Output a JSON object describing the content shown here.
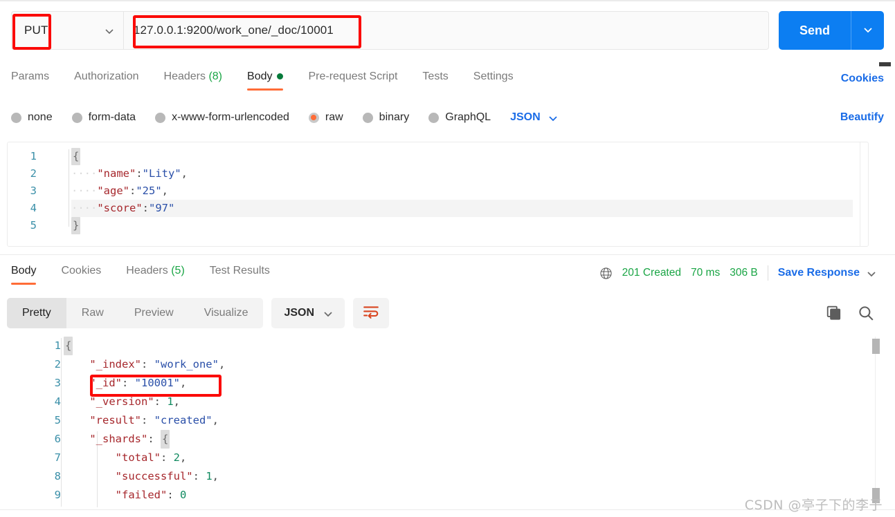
{
  "request": {
    "method": "PUT",
    "url": "127.0.0.1:9200/work_one/_doc/10001",
    "send_label": "Send",
    "tabs": [
      {
        "label": "Params",
        "active": false
      },
      {
        "label": "Authorization",
        "active": false
      },
      {
        "label": "Headers",
        "count": "(8)",
        "active": false
      },
      {
        "label": "Body",
        "active": true,
        "dot": true
      },
      {
        "label": "Pre-request Script",
        "active": false
      },
      {
        "label": "Tests",
        "active": false
      },
      {
        "label": "Settings",
        "active": false
      }
    ],
    "cookies_link": "Cookies",
    "body_types": [
      {
        "label": "none",
        "selected": false
      },
      {
        "label": "form-data",
        "selected": false
      },
      {
        "label": "x-www-form-urlencoded",
        "selected": false
      },
      {
        "label": "raw",
        "selected": true
      },
      {
        "label": "binary",
        "selected": false
      },
      {
        "label": "GraphQL",
        "selected": false
      }
    ],
    "format_selected": "JSON",
    "beautify_label": "Beautify",
    "body_lines": [
      {
        "n": "1",
        "text": "{"
      },
      {
        "n": "2",
        "key": "\"name\"",
        "val": "\"Lity\"",
        "comma": ","
      },
      {
        "n": "3",
        "key": "\"age\"",
        "val": "\"25\"",
        "comma": ","
      },
      {
        "n": "4",
        "key": "\"score\"",
        "val": "\"97\"",
        "comma": "",
        "highlight": true
      },
      {
        "n": "5",
        "text": "}"
      }
    ]
  },
  "response": {
    "tabs": [
      {
        "label": "Body",
        "active": true
      },
      {
        "label": "Cookies",
        "active": false
      },
      {
        "label": "Headers",
        "count": "(5)",
        "active": false
      },
      {
        "label": "Test Results",
        "active": false
      }
    ],
    "status": "201 Created",
    "time": "70 ms",
    "size": "306 B",
    "save_response_label": "Save Response",
    "view_modes": [
      {
        "label": "Pretty",
        "active": true
      },
      {
        "label": "Raw",
        "active": false
      },
      {
        "label": "Preview",
        "active": false
      },
      {
        "label": "Visualize",
        "active": false
      }
    ],
    "format_selected": "JSON",
    "body_lines": [
      {
        "n": "1",
        "indent": 0,
        "raw": "{"
      },
      {
        "n": "2",
        "indent": 1,
        "key": "\"_index\"",
        "val": "\"work_one\"",
        "type": "string",
        "comma": ","
      },
      {
        "n": "3",
        "indent": 1,
        "key": "\"_id\"",
        "val": "\"10001\"",
        "type": "string",
        "comma": ","
      },
      {
        "n": "4",
        "indent": 1,
        "key": "\"_version\"",
        "val": "1",
        "type": "number",
        "comma": ","
      },
      {
        "n": "5",
        "indent": 1,
        "key": "\"result\"",
        "val": "\"created\"",
        "type": "string",
        "comma": ","
      },
      {
        "n": "6",
        "indent": 1,
        "key": "\"_shards\"",
        "val": "{",
        "type": "open",
        "comma": ""
      },
      {
        "n": "7",
        "indent": 2,
        "key": "\"total\"",
        "val": "2",
        "type": "number",
        "comma": ","
      },
      {
        "n": "8",
        "indent": 2,
        "key": "\"successful\"",
        "val": "1",
        "type": "number",
        "comma": ","
      },
      {
        "n": "9",
        "indent": 2,
        "key": "\"failed\"",
        "val": "0",
        "type": "number",
        "comma": ""
      }
    ]
  },
  "watermark": "CSDN @亭子下的李子",
  "colors": {
    "accent_orange": "#ff6c37",
    "link_blue": "#1a6ce7",
    "send_blue": "#0c7ef2",
    "status_green": "#1aa545",
    "annotation_red": "#fb0a06"
  }
}
